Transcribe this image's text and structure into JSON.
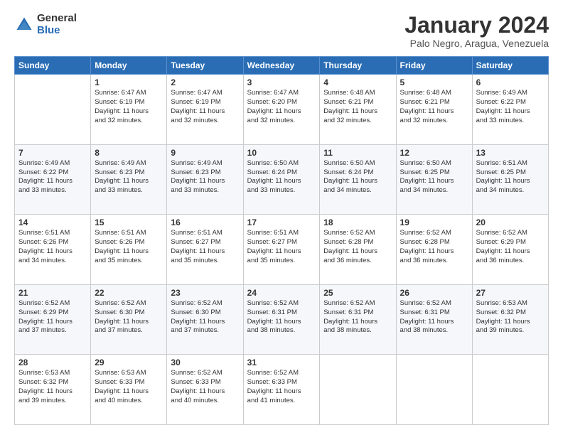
{
  "logo": {
    "general": "General",
    "blue": "Blue"
  },
  "header": {
    "title": "January 2024",
    "subtitle": "Palo Negro, Aragua, Venezuela"
  },
  "weekdays": [
    "Sunday",
    "Monday",
    "Tuesday",
    "Wednesday",
    "Thursday",
    "Friday",
    "Saturday"
  ],
  "weeks": [
    [
      {
        "day": "",
        "info": ""
      },
      {
        "day": "1",
        "info": "Sunrise: 6:47 AM\nSunset: 6:19 PM\nDaylight: 11 hours\nand 32 minutes."
      },
      {
        "day": "2",
        "info": "Sunrise: 6:47 AM\nSunset: 6:19 PM\nDaylight: 11 hours\nand 32 minutes."
      },
      {
        "day": "3",
        "info": "Sunrise: 6:47 AM\nSunset: 6:20 PM\nDaylight: 11 hours\nand 32 minutes."
      },
      {
        "day": "4",
        "info": "Sunrise: 6:48 AM\nSunset: 6:21 PM\nDaylight: 11 hours\nand 32 minutes."
      },
      {
        "day": "5",
        "info": "Sunrise: 6:48 AM\nSunset: 6:21 PM\nDaylight: 11 hours\nand 32 minutes."
      },
      {
        "day": "6",
        "info": "Sunrise: 6:49 AM\nSunset: 6:22 PM\nDaylight: 11 hours\nand 33 minutes."
      }
    ],
    [
      {
        "day": "7",
        "info": "Sunrise: 6:49 AM\nSunset: 6:22 PM\nDaylight: 11 hours\nand 33 minutes."
      },
      {
        "day": "8",
        "info": "Sunrise: 6:49 AM\nSunset: 6:23 PM\nDaylight: 11 hours\nand 33 minutes."
      },
      {
        "day": "9",
        "info": "Sunrise: 6:49 AM\nSunset: 6:23 PM\nDaylight: 11 hours\nand 33 minutes."
      },
      {
        "day": "10",
        "info": "Sunrise: 6:50 AM\nSunset: 6:24 PM\nDaylight: 11 hours\nand 33 minutes."
      },
      {
        "day": "11",
        "info": "Sunrise: 6:50 AM\nSunset: 6:24 PM\nDaylight: 11 hours\nand 34 minutes."
      },
      {
        "day": "12",
        "info": "Sunrise: 6:50 AM\nSunset: 6:25 PM\nDaylight: 11 hours\nand 34 minutes."
      },
      {
        "day": "13",
        "info": "Sunrise: 6:51 AM\nSunset: 6:25 PM\nDaylight: 11 hours\nand 34 minutes."
      }
    ],
    [
      {
        "day": "14",
        "info": "Sunrise: 6:51 AM\nSunset: 6:26 PM\nDaylight: 11 hours\nand 34 minutes."
      },
      {
        "day": "15",
        "info": "Sunrise: 6:51 AM\nSunset: 6:26 PM\nDaylight: 11 hours\nand 35 minutes."
      },
      {
        "day": "16",
        "info": "Sunrise: 6:51 AM\nSunset: 6:27 PM\nDaylight: 11 hours\nand 35 minutes."
      },
      {
        "day": "17",
        "info": "Sunrise: 6:51 AM\nSunset: 6:27 PM\nDaylight: 11 hours\nand 35 minutes."
      },
      {
        "day": "18",
        "info": "Sunrise: 6:52 AM\nSunset: 6:28 PM\nDaylight: 11 hours\nand 36 minutes."
      },
      {
        "day": "19",
        "info": "Sunrise: 6:52 AM\nSunset: 6:28 PM\nDaylight: 11 hours\nand 36 minutes."
      },
      {
        "day": "20",
        "info": "Sunrise: 6:52 AM\nSunset: 6:29 PM\nDaylight: 11 hours\nand 36 minutes."
      }
    ],
    [
      {
        "day": "21",
        "info": "Sunrise: 6:52 AM\nSunset: 6:29 PM\nDaylight: 11 hours\nand 37 minutes."
      },
      {
        "day": "22",
        "info": "Sunrise: 6:52 AM\nSunset: 6:30 PM\nDaylight: 11 hours\nand 37 minutes."
      },
      {
        "day": "23",
        "info": "Sunrise: 6:52 AM\nSunset: 6:30 PM\nDaylight: 11 hours\nand 37 minutes."
      },
      {
        "day": "24",
        "info": "Sunrise: 6:52 AM\nSunset: 6:31 PM\nDaylight: 11 hours\nand 38 minutes."
      },
      {
        "day": "25",
        "info": "Sunrise: 6:52 AM\nSunset: 6:31 PM\nDaylight: 11 hours\nand 38 minutes."
      },
      {
        "day": "26",
        "info": "Sunrise: 6:52 AM\nSunset: 6:31 PM\nDaylight: 11 hours\nand 38 minutes."
      },
      {
        "day": "27",
        "info": "Sunrise: 6:53 AM\nSunset: 6:32 PM\nDaylight: 11 hours\nand 39 minutes."
      }
    ],
    [
      {
        "day": "28",
        "info": "Sunrise: 6:53 AM\nSunset: 6:32 PM\nDaylight: 11 hours\nand 39 minutes."
      },
      {
        "day": "29",
        "info": "Sunrise: 6:53 AM\nSunset: 6:33 PM\nDaylight: 11 hours\nand 40 minutes."
      },
      {
        "day": "30",
        "info": "Sunrise: 6:52 AM\nSunset: 6:33 PM\nDaylight: 11 hours\nand 40 minutes."
      },
      {
        "day": "31",
        "info": "Sunrise: 6:52 AM\nSunset: 6:33 PM\nDaylight: 11 hours\nand 41 minutes."
      },
      {
        "day": "",
        "info": ""
      },
      {
        "day": "",
        "info": ""
      },
      {
        "day": "",
        "info": ""
      }
    ]
  ]
}
